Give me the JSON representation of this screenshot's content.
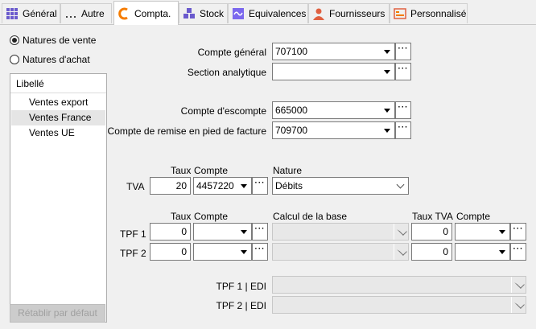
{
  "tabs": [
    {
      "label": "Général",
      "icon": "grid-icon"
    },
    {
      "label": "Autre",
      "icon": "ellipsis-icon"
    },
    {
      "label": "Compta.",
      "icon": "accounting-icon"
    },
    {
      "label": "Stock",
      "icon": "stock-icon"
    },
    {
      "label": "Equivalences",
      "icon": "equivalence-icon"
    },
    {
      "label": "Fournisseurs",
      "icon": "supplier-icon"
    },
    {
      "label": "Personnalisé",
      "icon": "custom-icon"
    }
  ],
  "radios": {
    "vente": "Natures de vente",
    "achat": "Natures d'achat",
    "selected": "vente"
  },
  "list": {
    "header": "Libellé",
    "items": [
      "Ventes export",
      "Ventes France",
      "Ventes UE"
    ],
    "selected": "Ventes France"
  },
  "reset_button": "Rétablir par défaut",
  "fields": {
    "compte_general": {
      "label": "Compte général",
      "value": "707100"
    },
    "section_analytique": {
      "label": "Section analytique",
      "value": ""
    },
    "compte_escompte": {
      "label": "Compte d'escompte",
      "value": "665000"
    },
    "compte_remise": {
      "label": "Compte de remise en pied de facture",
      "value": "709700"
    }
  },
  "tva": {
    "headers": {
      "taux": "Taux",
      "compte": "Compte",
      "nature": "Nature"
    },
    "label": "TVA",
    "taux": "20",
    "compte": "4457220",
    "nature": "Débits"
  },
  "tpf": {
    "headers": {
      "taux": "Taux",
      "compte": "Compte",
      "calcul": "Calcul de la base",
      "taux_tva": "Taux TVA",
      "compte2": "Compte"
    },
    "rows": [
      {
        "label": "TPF 1",
        "taux": "0",
        "taux_tva": "0"
      },
      {
        "label": "TPF 2",
        "taux": "0",
        "taux_tva": "0"
      }
    ]
  },
  "edi": {
    "tpf1": {
      "label": "TPF 1 | EDI",
      "value": ""
    },
    "tpf2": {
      "label": "TPF 2 | EDI",
      "value": ""
    }
  },
  "colors": {
    "accent": "#f57c00",
    "stock": "#6a5acd",
    "equiv": "#7b68ee",
    "supplier": "#e06040"
  }
}
